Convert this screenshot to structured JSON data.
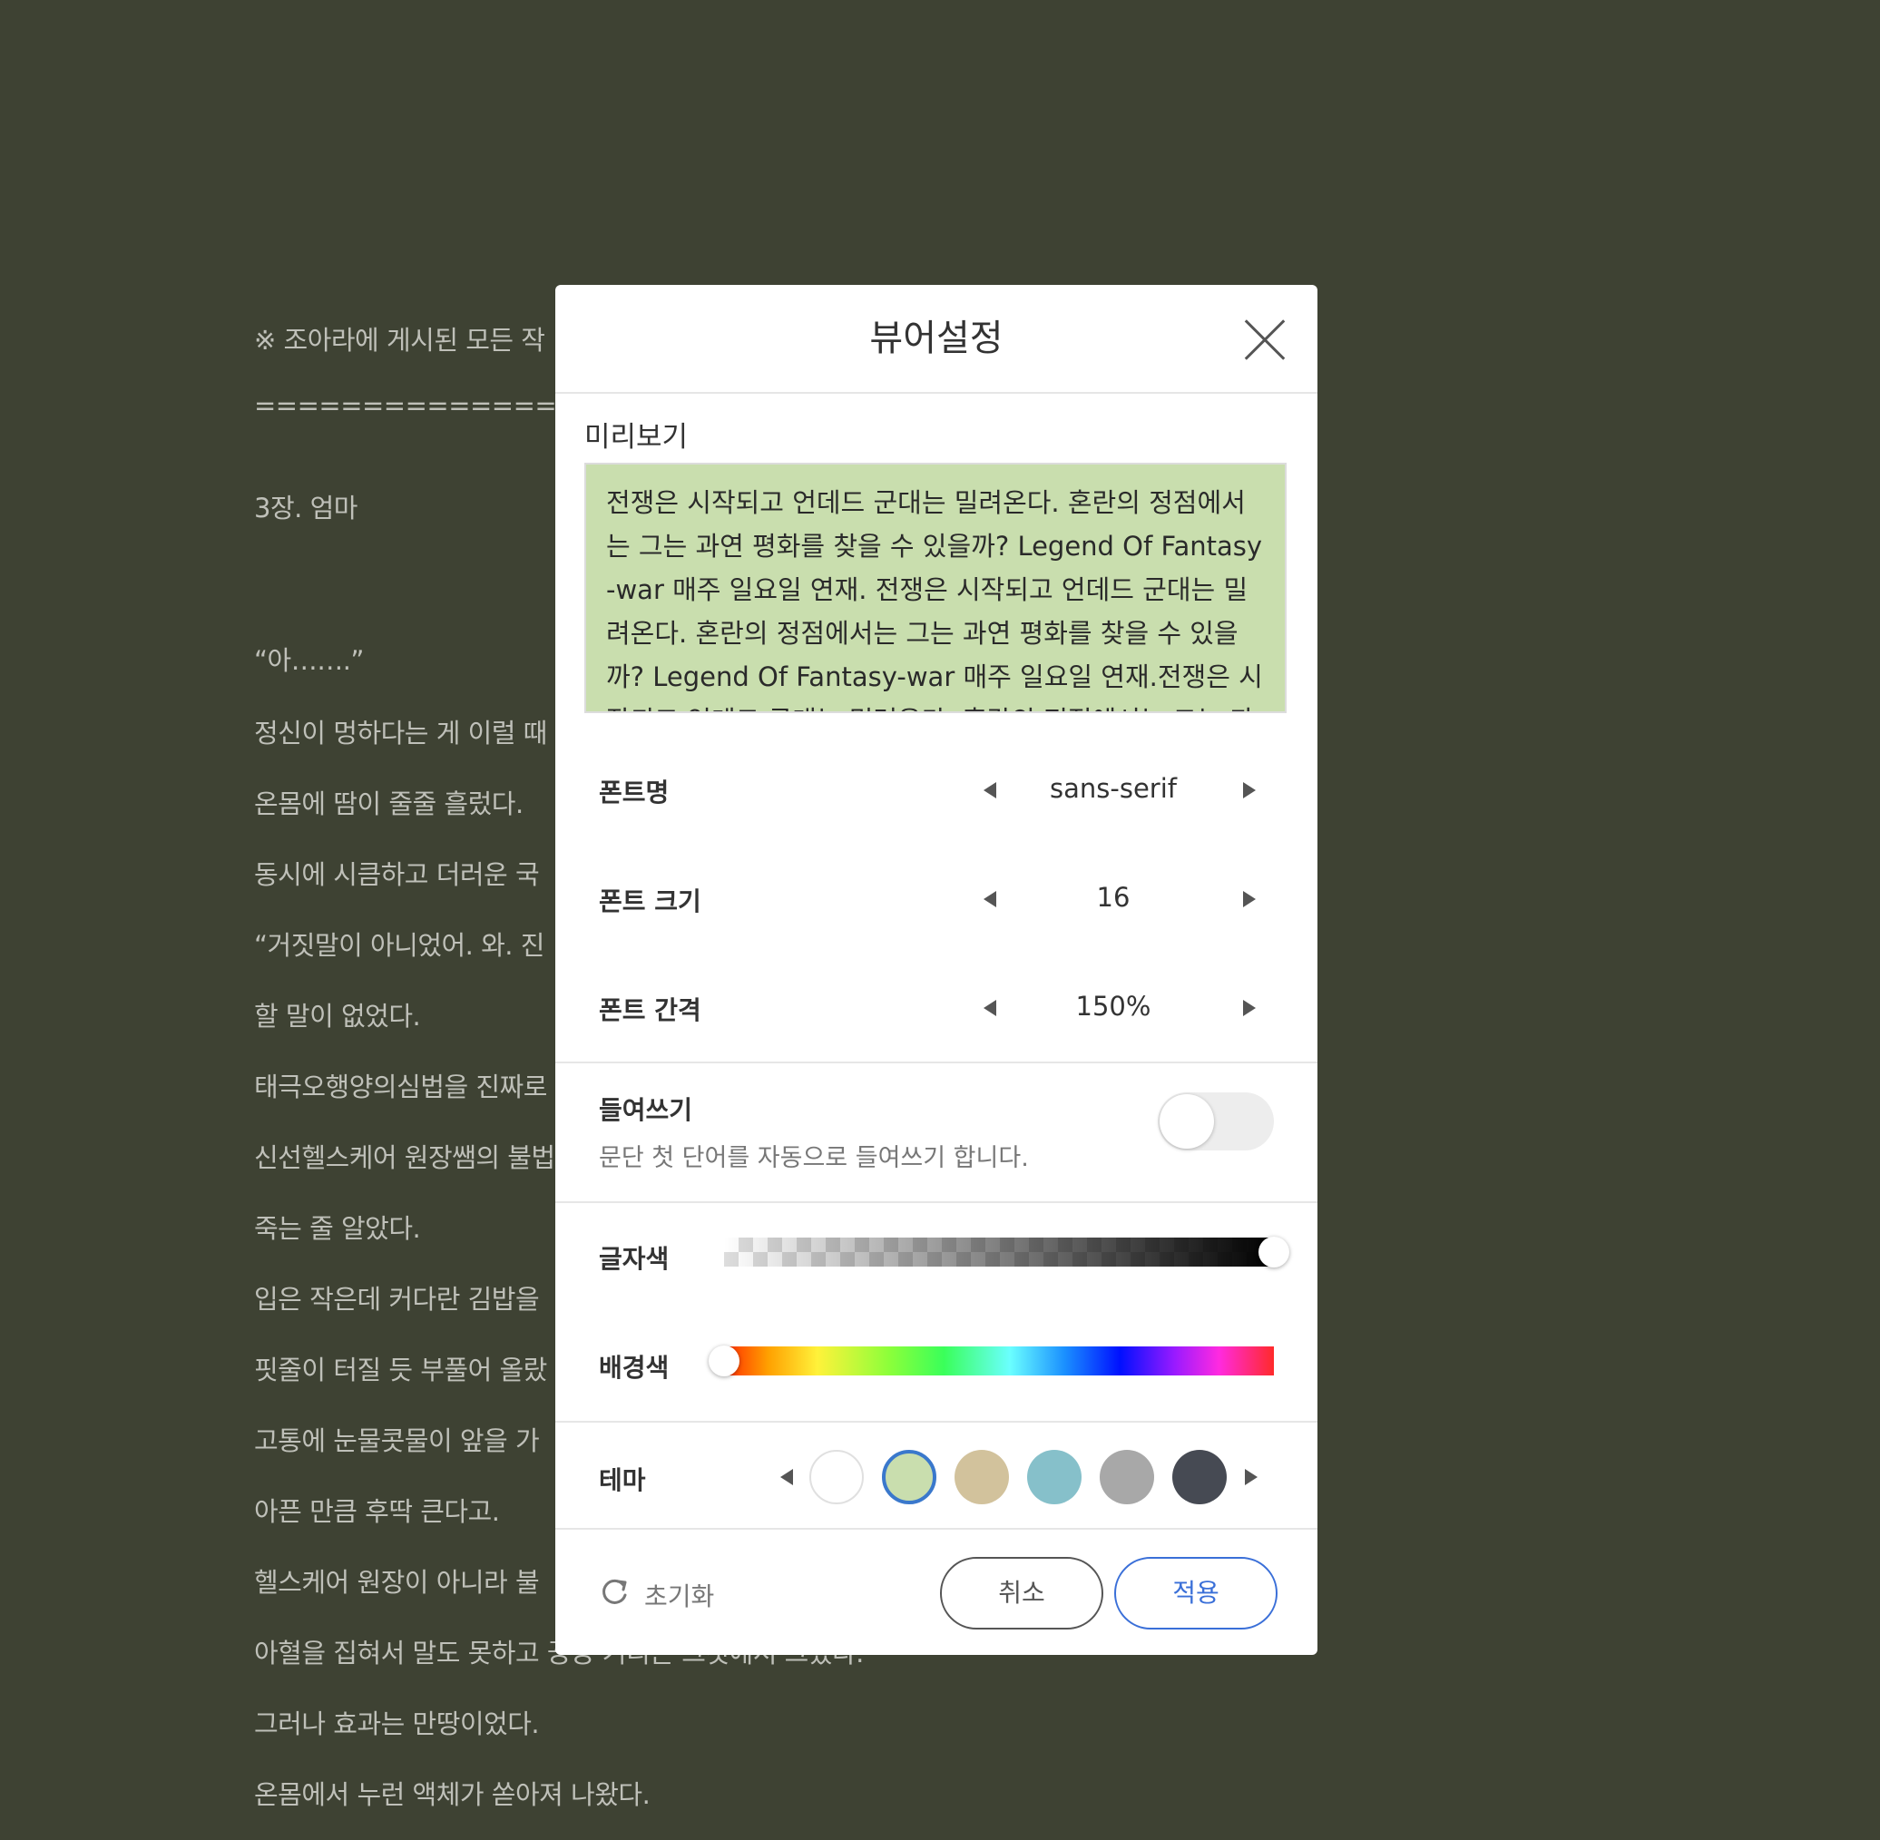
{
  "reader": {
    "lines": [
      "※ 조아라에 게시된 모든 작",
      "====================",
      "3장. 엄마",
      "“아…….”",
      "정신이 멍하다는 게 이럴 때",
      "온몸에 땀이 줄줄 흘렀다.",
      "동시에 시큼하고 더러운 국",
      "“거짓말이 아니었어. 와. 진",
      "할 말이 없었다.",
      "태극오행양의심법을 진짜로",
      "신선헬스케어 원장쌤의 불법",
      "죽는 줄 알았다.",
      "입은 작은데 커다란 김밥을",
      "핏줄이 터질 듯 부풀어 올랐",
      "고통에 눈물콧물이 앞을 가",
      "아픈 만큼 후딱 큰다고.",
      "헬스케어 원장이 아니라 불",
      "아혈을 집혀서 말도 못하고 끙끙 거리는 그것에서 그쳤다.",
      "그러나 효과는 만땅이었다.",
      "온몸에서 누런 액체가 쏟아져 나왔다."
    ]
  },
  "modal": {
    "title": "뷰어설정",
    "close_icon": "close-icon",
    "preview": {
      "label": "미리보기",
      "text": "전쟁은 시작되고 언데드 군대는 밀려온다. 혼란의 정점에서는 그는 과연 평화를 찾을 수 있을까? Legend Of Fantasy-war 매주 일요일 연재. 전쟁은 시작되고 언데드 군대는 밀려온다. 혼란의 정점에서는 그는 과연 평화를 찾을 수 있을까? Legend Of Fantasy-war 매주 일요일 연재.전쟁은 시작되고 언데드 군대는 밀려온다. 혼란의 정점에서는 그는 과",
      "background": "#c9deae"
    },
    "font_name": {
      "label": "폰트명",
      "value": "sans-serif"
    },
    "font_size": {
      "label": "폰트 크기",
      "value": "16"
    },
    "font_spacing": {
      "label": "폰트 간격",
      "value": "150%"
    },
    "indent": {
      "label": "들여쓰기",
      "description": "문단 첫 단어를 자동으로 들여쓰기 합니다.",
      "enabled": false
    },
    "text_color": {
      "label": "글자색",
      "level": 1.0
    },
    "bg_color": {
      "label": "배경색",
      "level": 0.0
    },
    "theme": {
      "label": "테마",
      "swatches": [
        "#ffffff",
        "#c9deae",
        "#d2c29c",
        "#86c0ca",
        "#a8a8a8",
        "#464a53"
      ],
      "selected_index": 1
    },
    "reset": {
      "label": "초기화",
      "icon": "refresh-icon"
    },
    "cancel_label": "취소",
    "apply_label": "적용",
    "accent_color": "#3a6fd8"
  }
}
